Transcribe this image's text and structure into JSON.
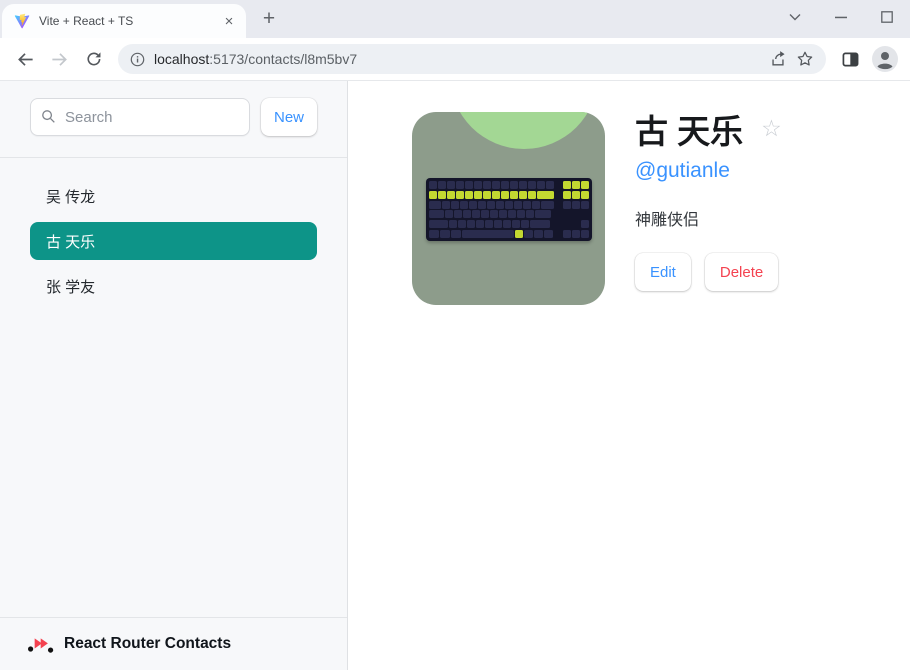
{
  "browser": {
    "tab_title": "Vite + React + TS",
    "close_tab_glyph": "×",
    "new_tab_glyph": "+",
    "url_host": "localhost",
    "url_path": ":5173/contacts/l8m5bv7"
  },
  "sidebar": {
    "search_placeholder": "Search",
    "new_button_label": "New",
    "contacts": [
      {
        "name": "吴 传龙",
        "active": false
      },
      {
        "name": "古 天乐",
        "active": true
      },
      {
        "name": "张 学友",
        "active": false
      }
    ],
    "footer_label": "React Router Contacts"
  },
  "detail": {
    "name": "古 天乐",
    "favorite": false,
    "favorite_glyph": "☆",
    "twitter": "@gutianle",
    "notes": "神雕侠侣",
    "edit_label": "Edit",
    "delete_label": "Delete"
  },
  "colors": {
    "accent_blue": "#3992ff",
    "accent_red": "#f44250",
    "active_teal": "#0d9488",
    "avatar_bg": "#8d9c8b",
    "avatar_circle": "#a3d794",
    "kb_body": "#14152a",
    "kb_key": "#2a2c4e",
    "kb_accent": "#c3d831"
  }
}
